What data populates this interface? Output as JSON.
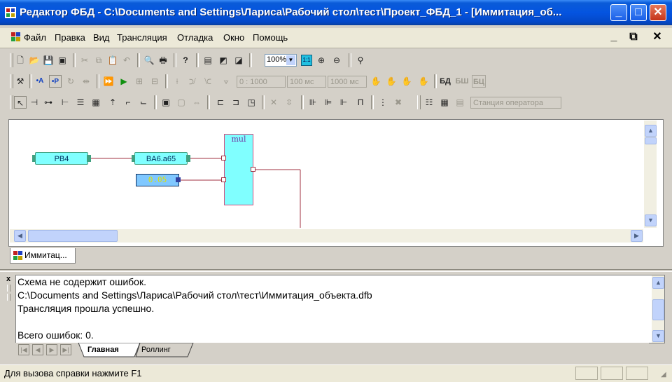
{
  "window": {
    "title": "Редактор ФБД - C:\\Documents and Settings\\Лариса\\Рабочий стол\\тест\\Проект_ФБД_1 - [Иммитация_об...",
    "minimize": "_",
    "maximize": "□",
    "close": "✕"
  },
  "menu": {
    "items": [
      "Файл",
      "Правка",
      "Вид",
      "Трансляция",
      "Отладка",
      "Окно",
      "Помощь"
    ],
    "mdi_minimize": "_",
    "mdi_restore": "⧉",
    "mdi_close": "✕"
  },
  "toolbar1": {
    "zoom_value": "100%",
    "ratio_label": "1:1"
  },
  "toolbar2": {
    "field_ratio": "0 : 1000",
    "field_period1": "100 мс",
    "field_period2": "1000 мс",
    "label_bd": "БД",
    "label_bsh": "БШ",
    "label_bc": "БЦ"
  },
  "toolbar3": {
    "station_field": "Станция оператора",
    "pi_label": "П"
  },
  "diagram": {
    "blocks": [
      {
        "label": "PB4"
      },
      {
        "label": "BA6.a65"
      },
      {
        "label": "0.05"
      }
    ],
    "function_block": "mul",
    "colors": {
      "block_fill": "#80ffff",
      "wire": "#a03040",
      "constant_text": "#e0e000"
    }
  },
  "doc_tab": {
    "label": "Иммитац..."
  },
  "output": {
    "lines": [
      "   Схема не содержит ошибок.",
      "C:\\Documents and Settings\\Лариса\\Рабочий стол\\тест\\Иммитация_объекта.dfb",
      "   Трансляция прошла успешно.",
      "",
      "Всего ошибок: 0."
    ],
    "close_glyph": "x",
    "tabs": [
      "Главная",
      "Роллинг"
    ]
  },
  "status": {
    "text": "Для вызова справки нажмите F1"
  }
}
